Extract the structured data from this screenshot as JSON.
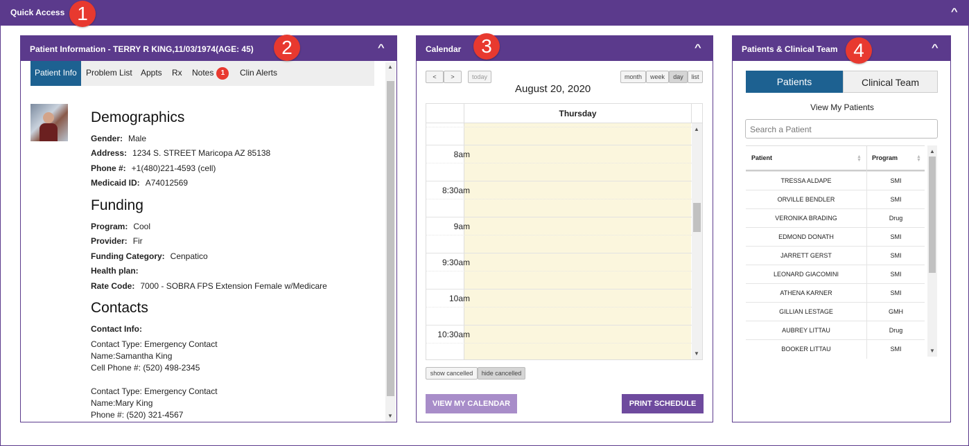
{
  "quick_access": {
    "title": "Quick Access"
  },
  "callouts": [
    "1",
    "2",
    "3",
    "4"
  ],
  "patient_info": {
    "header": "Patient Information - TERRY R KING,11/03/1974(AGE: 45)",
    "tabs": [
      "Patient Info",
      "Problem List",
      "Appts",
      "Rx",
      "Notes",
      "Clin Alerts"
    ],
    "notes_count": "1",
    "demographics": {
      "heading": "Demographics",
      "fields": [
        {
          "label": "Gender:",
          "value": "Male"
        },
        {
          "label": "Address:",
          "value": "1234 S. STREET Maricopa AZ 85138"
        },
        {
          "label": "Phone #:",
          "value": "+1(480)221-4593 (cell)"
        },
        {
          "label": "Medicaid ID:",
          "value": "A74012569"
        }
      ]
    },
    "funding": {
      "heading": "Funding",
      "fields": [
        {
          "label": "Program:",
          "value": "Cool"
        },
        {
          "label": "Provider:",
          "value": "Fir"
        },
        {
          "label": "Funding Category:",
          "value": "Cenpatico"
        },
        {
          "label": "Health plan:",
          "value": ""
        },
        {
          "label": "Rate Code:",
          "value": "7000 - SOBRA FPS Extension Female w/Medicare"
        }
      ]
    },
    "contacts": {
      "heading": "Contacts",
      "info_label": "Contact Info:",
      "lines": [
        "Contact Type: Emergency Contact",
        "Name:Samantha King",
        "Cell Phone #: (520) 498-2345",
        "Contact Type: Emergency Contact",
        "Name:Mary King",
        "Phone #: (520) 321-4567"
      ]
    }
  },
  "calendar": {
    "header": "Calendar",
    "prev": "<",
    "next": ">",
    "today": "today",
    "views": [
      "month",
      "week",
      "day",
      "list"
    ],
    "active_view": "day",
    "date_title": "August 20, 2020",
    "day_header": "Thursday",
    "times": [
      "8am",
      "8:30am",
      "9am",
      "9:30am",
      "10am",
      "10:30am"
    ],
    "show_cancelled": "show cancelled",
    "hide_cancelled": "hide cancelled",
    "view_my_calendar": "VIEW MY CALENDAR",
    "print_schedule": "PRINT SCHEDULE"
  },
  "patients_team": {
    "header": "Patients & Clinical Team",
    "toggle_patients": "Patients",
    "toggle_team": "Clinical Team",
    "view_label": "View My Patients",
    "search_placeholder": "Search a Patient",
    "columns": [
      "Patient",
      "Program"
    ],
    "rows": [
      {
        "name": "TRESSA ALDAPE",
        "program": "SMI"
      },
      {
        "name": "ORVILLE BENDLER",
        "program": "SMI"
      },
      {
        "name": "VERONIKA BRADING",
        "program": "Drug"
      },
      {
        "name": "EDMOND DONATH",
        "program": "SMI"
      },
      {
        "name": "JARRETT GERST",
        "program": "SMI"
      },
      {
        "name": "LEONARD GIACOMINI",
        "program": "SMI"
      },
      {
        "name": "ATHENA KARNER",
        "program": "SMI"
      },
      {
        "name": "GILLIAN LESTAGE",
        "program": "GMH"
      },
      {
        "name": "AUBREY LITTAU",
        "program": "Drug"
      },
      {
        "name": "BOOKER LITTAU",
        "program": "SMI"
      }
    ]
  },
  "colors": {
    "purple": "#5b3a8c",
    "blue": "#1d6191",
    "badge_red": "#e8392f",
    "cal_day": "#fbf6dd"
  }
}
